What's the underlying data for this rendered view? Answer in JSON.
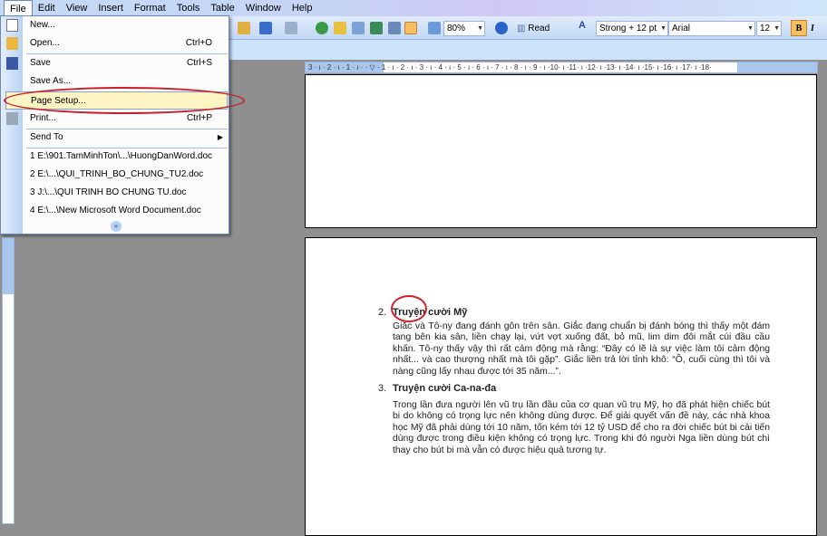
{
  "menubar": {
    "items": [
      "File",
      "Edit",
      "View",
      "Insert",
      "Format",
      "Tools",
      "Table",
      "Window",
      "Help"
    ]
  },
  "toolbar": {
    "zoom": "80%",
    "read": "Read",
    "style": "Strong + 12 pt",
    "font": "Arial",
    "size": "12",
    "bold": "B",
    "italic": "I"
  },
  "ruler": {
    "labels": "3 · ı · 2 · ı · 1 · ı ·   · ▽ · 1 · ı · 2 · ı · 3 · ı · 4 · ı · 5 · ı · 6 · ı · 7 · ı · 8 · ı · 9 · ı ·10· ı ·11· ı ·12· ı ·13· ı ·14· ı ·15· ı ·16· ı ·17· ı ·18·"
  },
  "file_menu": {
    "new": "New...",
    "open": "Open...",
    "open_sc": "Ctrl+O",
    "save": "Save",
    "save_sc": "Ctrl+S",
    "save_as": "Save As...",
    "page_setup": "Page Setup...",
    "print": "Print...",
    "print_sc": "Ctrl+P",
    "send_to": "Send To",
    "recent": [
      "1 E:\\901.TamMinhTon\\...\\HuongDanWord.doc",
      "2 E:\\...\\QUI_TRINH_BO_CHUNG_TU2.doc",
      "3 J:\\...\\QUI TRINH BO CHUNG TU.doc",
      "4 E:\\...\\New Microsoft Word Document.doc"
    ]
  },
  "document": {
    "items": [
      {
        "num": "2.",
        "title": "Truyện cười Mỹ",
        "body": "Giắc và Tô-ny đang đánh gôn trên sân. Giắc đang chuẩn bị đánh bóng thì thấy một đám tang bên kia sân, liền chạy lại, vứt vợt xuống đất, bỏ mũ, lim dim đôi mắt cúi đầu cầu khấn. Tô-ny thấy vậy thì rất cảm động mà rằng: “Đây có lẽ là sự việc làm tôi cảm động nhất... và cao thượng nhất mà tôi gặp”. Giắc liền trả lời tỉnh khô: “Ồ, cuối cùng thì tôi và nàng cũng lấy nhau được tới 35 năm...”."
      },
      {
        "num": "3.",
        "title": "Truyện cười Ca-na-đa",
        "body": "Trong lần đưa người lên vũ trụ lần đầu của cơ quan vũ trụ Mỹ, họ đã phát hiện chiếc bút bi do không có trọng lực nên không dùng được. Để giải quyết vấn đề này, các nhà khoa học Mỹ đã phải dùng tới 10 năm, tốn kém tới 12 tỷ USD để cho ra đời chiếc bút bi cải tiến dùng được trong điều kiện không có trọng lực. Trong khi đó người Nga liền dùng bút chì thay cho bút bi mà vẫn có được hiệu quả tương tự."
      }
    ]
  }
}
